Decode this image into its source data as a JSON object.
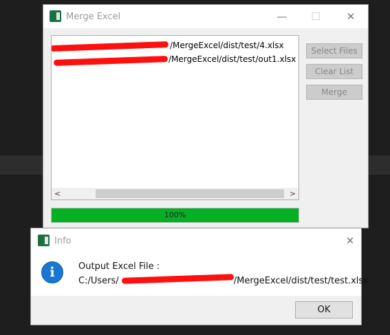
{
  "main_window": {
    "title": "Merge Excel",
    "controls": {
      "minimize": "—",
      "maximize": "☐",
      "close": "✕"
    },
    "file_list": [
      "/MergeExcel/dist/test/4.xlsx",
      "/MergeExcel/dist/test/out1.xlsx"
    ],
    "buttons": {
      "select_files": "Select Files",
      "clear_list": "Clear List",
      "merge": "Merge"
    },
    "scroll_arrows": {
      "left": "<",
      "right": ">"
    },
    "progress": {
      "value": 1.0,
      "label": "100%",
      "color": "#06b025"
    }
  },
  "info_dialog": {
    "title": "Info",
    "close": "✕",
    "icon": "info-icon",
    "icon_glyph": "i",
    "message_line1": "Output Excel File :",
    "message_prefix": "C:/Users/",
    "message_suffix": "/MergeExcel/dist/test/test.xlsx",
    "ok_label": "OK"
  },
  "colors": {
    "redaction": "#ff1010",
    "excel_green": "#1d6f42",
    "info_blue": "#1877d2"
  }
}
